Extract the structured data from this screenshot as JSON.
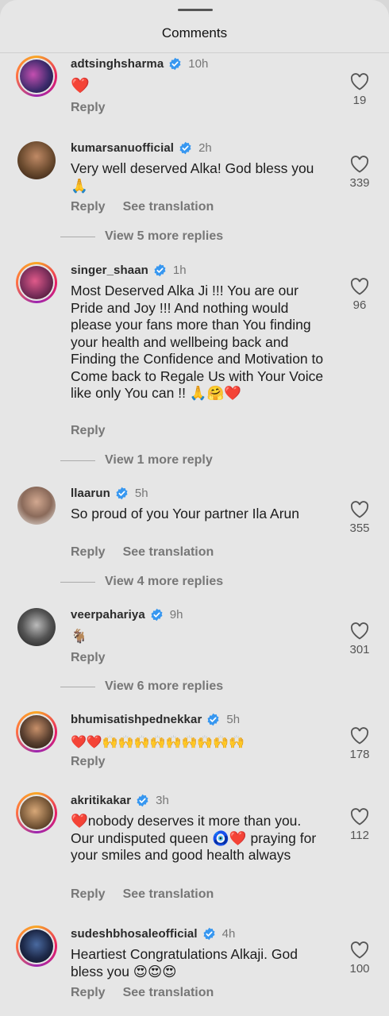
{
  "sheet": {
    "title": "Comments"
  },
  "comments": [
    {
      "username": "adtsinghsharma",
      "time": "10h",
      "text": "❤️",
      "likes": "19",
      "actions": [
        "Reply"
      ],
      "avatar_color": "#3b2a6b"
    },
    {
      "username": "kumarsanuofficial",
      "time": "2h",
      "text": "Very well deserved Alka! God bless you 🙏",
      "likes": "339",
      "actions": [
        "Reply",
        "See translation"
      ],
      "view_more": "View 5 more replies",
      "avatar_color": "#6a4a2e"
    },
    {
      "username": "singer_shaan",
      "time": "1h",
      "text": "Most Deserved Alka Ji !!! You are our Pride and Joy !!! And nothing would please your fans more than You finding your health and wellbeing back and Finding the Confidence and Motivation to Come back to Regale Us with Your Voice like only You can !! 🙏🤗❤️",
      "likes": "96",
      "actions": [
        "Reply"
      ],
      "view_more": "View 1 more reply",
      "avatar_color": "#7a2e5a"
    },
    {
      "username": "llaarun",
      "time": "5h",
      "text": "So proud of you Your partner Ila Arun",
      "likes": "355",
      "actions": [
        "Reply",
        "See translation"
      ],
      "view_more": "View 4 more replies",
      "avatar_color": "#8a6a5a"
    },
    {
      "username": "veerpahariya",
      "time": "9h",
      "text": "🐐",
      "likes": "301",
      "actions": [
        "Reply"
      ],
      "view_more": "View 6 more replies",
      "avatar_color": "#3a3a3a"
    },
    {
      "username": "bhumisatishpednekkar",
      "time": "5h",
      "text": "❤️❤️🙌🙌🙌🙌🙌🙌🙌🙌🙌",
      "likes": "178",
      "actions": [
        "Reply"
      ],
      "avatar_color": "#5a4030"
    },
    {
      "username": "akritikakar",
      "time": "3h",
      "text": "❤️nobody deserves it more than you. Our undisputed queen 🧿❤️ praying for your smiles and good health always",
      "likes": "112",
      "actions": [
        "Reply",
        "See translation"
      ],
      "avatar_color": "#7a5a3a"
    },
    {
      "username": "sudeshbhosaleofficial",
      "time": "4h",
      "text": "Heartiest Congratulations Alkaji. God bless you 😍😍😍",
      "likes": "100",
      "actions": [
        "Reply",
        "See translation"
      ],
      "avatar_color": "#1e2a4a"
    }
  ],
  "colors": {
    "verified": "#3797f0",
    "background": "#e6e6e6",
    "muted": "#777777"
  },
  "icons": {
    "verified": "verified-badge-icon",
    "like": "heart-outline-icon"
  }
}
